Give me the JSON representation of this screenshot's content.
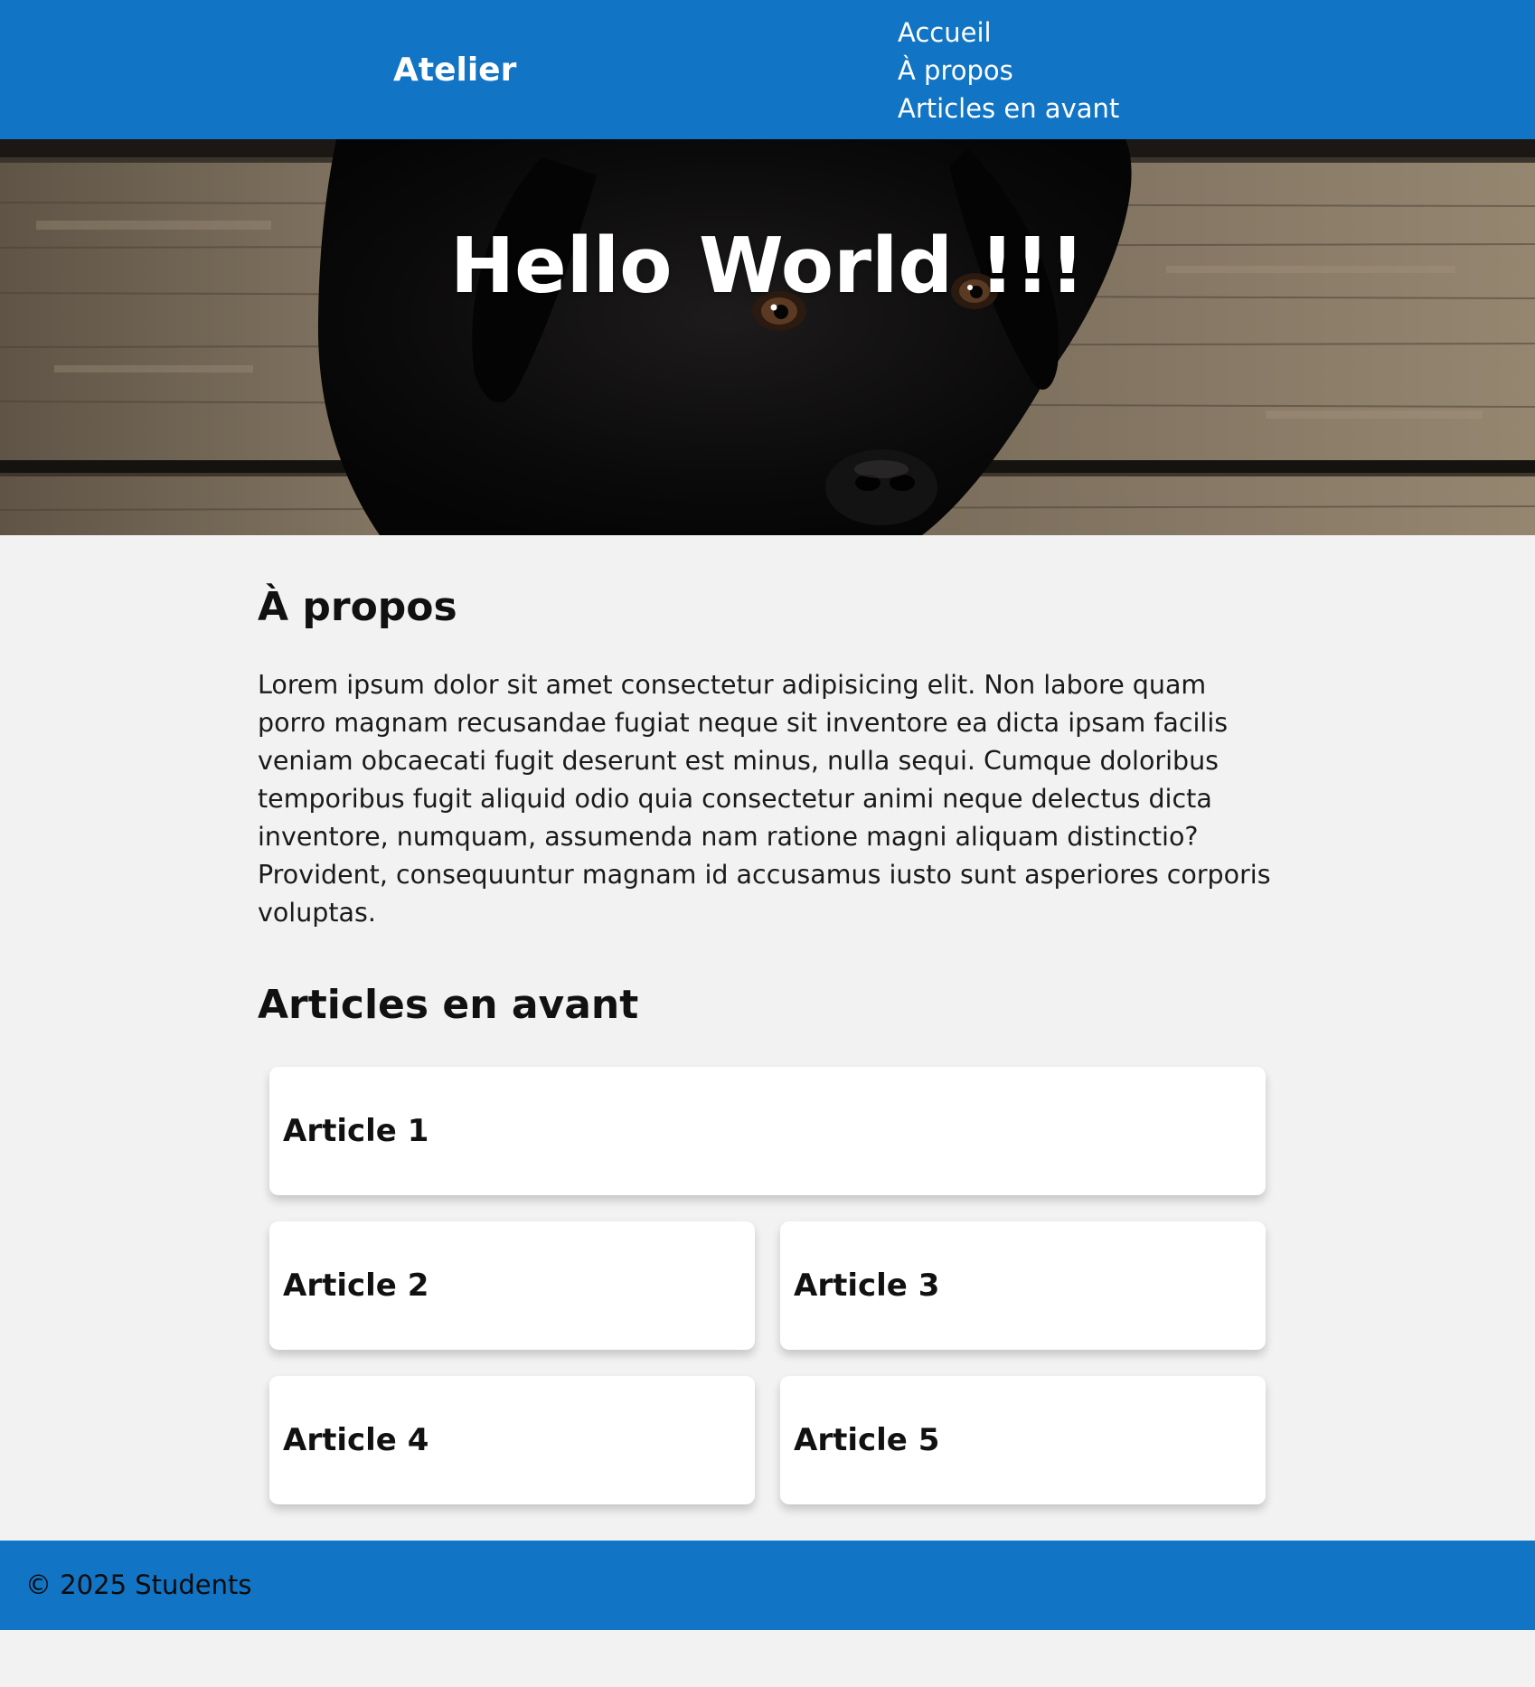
{
  "header": {
    "brand": "Atelier",
    "nav": [
      "Accueil",
      "À propos",
      "Articles en avant"
    ]
  },
  "hero": {
    "title": "Hello World !!!"
  },
  "about": {
    "title": "À propos",
    "text": "Lorem ipsum dolor sit amet consectetur adipisicing elit. Non labore quam porro magnam recusandae fugiat neque sit inventore ea dicta ipsam facilis veniam obcaecati fugit deserunt est minus, nulla sequi. Cumque doloribus temporibus fugit aliquid odio quia consectetur animi neque delectus dicta inventore, numquam, assumenda nam ratione magni aliquam distinctio? Provident, consequuntur magnam id accusamus iusto sunt asperiores corporis voluptas."
  },
  "articles": {
    "title": "Articles en avant",
    "items": [
      "Article 1",
      "Article 2",
      "Article 3",
      "Article 4",
      "Article 5"
    ]
  },
  "footer": {
    "text": "© 2025 Students"
  },
  "colors": {
    "primary": "#1274c4",
    "background": "#f2f2f2",
    "card": "#ffffff"
  }
}
